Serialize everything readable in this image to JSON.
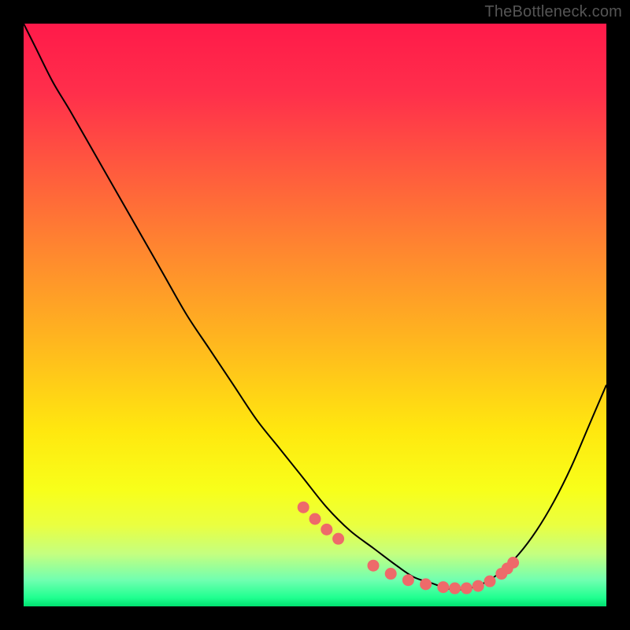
{
  "watermark": "TheBottleneck.com",
  "chart_data": {
    "type": "line",
    "title": "",
    "xlabel": "",
    "ylabel": "",
    "xlim": [
      0,
      100
    ],
    "ylim": [
      0,
      100
    ],
    "gradient_stops": [
      {
        "offset": 0.0,
        "color": "#ff1a4a"
      },
      {
        "offset": 0.12,
        "color": "#ff2f4b"
      },
      {
        "offset": 0.25,
        "color": "#ff5a3e"
      },
      {
        "offset": 0.4,
        "color": "#ff8a2e"
      },
      {
        "offset": 0.55,
        "color": "#ffb81e"
      },
      {
        "offset": 0.7,
        "color": "#ffe80f"
      },
      {
        "offset": 0.8,
        "color": "#f8ff1a"
      },
      {
        "offset": 0.86,
        "color": "#eaff40"
      },
      {
        "offset": 0.91,
        "color": "#c4ff80"
      },
      {
        "offset": 0.955,
        "color": "#70ffb0"
      },
      {
        "offset": 0.985,
        "color": "#20ff90"
      },
      {
        "offset": 1.0,
        "color": "#00e070"
      }
    ],
    "series": [
      {
        "name": "curve",
        "type": "line",
        "x": [
          0,
          2,
          5,
          8,
          12,
          16,
          20,
          24,
          28,
          32,
          36,
          40,
          44,
          48,
          52,
          56,
          60,
          64,
          67,
          70,
          73,
          76,
          79,
          82,
          85,
          88,
          91,
          94,
          97,
          100
        ],
        "y": [
          100,
          96,
          90,
          85,
          78,
          71,
          64,
          57,
          50,
          44,
          38,
          32,
          27,
          22,
          17,
          13,
          10,
          7,
          5,
          4,
          3,
          3,
          4,
          6,
          9,
          13,
          18,
          24,
          31,
          38
        ]
      },
      {
        "name": "markers",
        "type": "scatter",
        "x": [
          48,
          50,
          52,
          54,
          60,
          63,
          66,
          69,
          72,
          74,
          76,
          78,
          80,
          82,
          83,
          84
        ],
        "y": [
          17.0,
          15.0,
          13.2,
          11.6,
          7.0,
          5.6,
          4.5,
          3.8,
          3.3,
          3.1,
          3.1,
          3.5,
          4.3,
          5.6,
          6.5,
          7.5
        ]
      }
    ],
    "marker_color": "#ee6a6a",
    "curve_color": "#000000"
  }
}
